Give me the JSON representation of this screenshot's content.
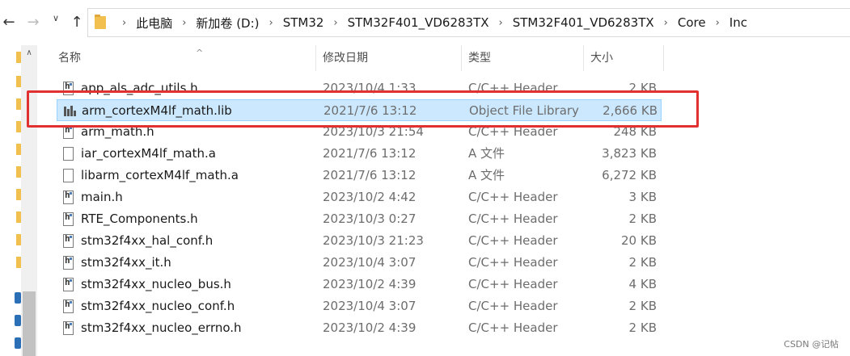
{
  "breadcrumbs": [
    "此电脑",
    "新加卷 (D:)",
    "STM32",
    "STM32F401_VD6283TX",
    "STM32F401_VD6283TX",
    "Core",
    "Inc"
  ],
  "columns": {
    "name": "名称",
    "date": "修改日期",
    "type": "类型",
    "size": "大小"
  },
  "files": [
    {
      "name": "app_als_adc_utils.h",
      "date": "2023/10/4 1:33",
      "type": "C/C++ Header",
      "size": "2 KB",
      "icon": "header-file-icon",
      "selected": false
    },
    {
      "name": "arm_cortexM4lf_math.lib",
      "date": "2021/7/6 13:12",
      "type": "Object File Library",
      "size": "2,666 KB",
      "icon": "library-file-icon",
      "selected": true
    },
    {
      "name": "arm_math.h",
      "date": "2023/10/3 21:54",
      "type": "C/C++ Header",
      "size": "248 KB",
      "icon": "header-file-icon",
      "selected": false
    },
    {
      "name": "iar_cortexM4lf_math.a",
      "date": "2021/7/6 13:12",
      "type": "A 文件",
      "size": "3,823 KB",
      "icon": "blank-file-icon",
      "selected": false
    },
    {
      "name": "libarm_cortexM4lf_math.a",
      "date": "2021/7/6 13:12",
      "type": "A 文件",
      "size": "6,272 KB",
      "icon": "blank-file-icon",
      "selected": false
    },
    {
      "name": "main.h",
      "date": "2023/10/2 4:42",
      "type": "C/C++ Header",
      "size": "3 KB",
      "icon": "header-file-icon",
      "selected": false
    },
    {
      "name": "RTE_Components.h",
      "date": "2023/10/3 0:27",
      "type": "C/C++ Header",
      "size": "2 KB",
      "icon": "header-file-icon",
      "selected": false
    },
    {
      "name": "stm32f4xx_hal_conf.h",
      "date": "2023/10/3 21:23",
      "type": "C/C++ Header",
      "size": "20 KB",
      "icon": "header-file-icon",
      "selected": false
    },
    {
      "name": "stm32f4xx_it.h",
      "date": "2023/10/4 3:07",
      "type": "C/C++ Header",
      "size": "2 KB",
      "icon": "header-file-icon",
      "selected": false
    },
    {
      "name": "stm32f4xx_nucleo_bus.h",
      "date": "2023/10/2 4:39",
      "type": "C/C++ Header",
      "size": "4 KB",
      "icon": "header-file-icon",
      "selected": false
    },
    {
      "name": "stm32f4xx_nucleo_conf.h",
      "date": "2023/10/4 3:07",
      "type": "C/C++ Header",
      "size": "2 KB",
      "icon": "header-file-icon",
      "selected": false
    },
    {
      "name": "stm32f4xx_nucleo_errno.h",
      "date": "2023/10/2 4:39",
      "type": "C/C++ Header",
      "size": "2 KB",
      "icon": "header-file-icon",
      "selected": false
    }
  ],
  "watermark": "CSDN @记帖",
  "colors": {
    "selection": "#cce8ff",
    "highlight": "#e03030",
    "folder": "#f2c04f"
  }
}
